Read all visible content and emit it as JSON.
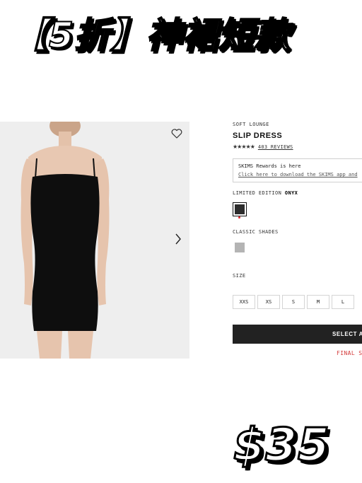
{
  "overlay": {
    "headline": "【5折】神裙短款",
    "price": "$35"
  },
  "product": {
    "collection": "SOFT LOUNGE",
    "title": "SLIP DRESS",
    "stars": "★★★★★",
    "rating_value": 4.5,
    "reviews": "403 REVIEWS",
    "rewards_title": "SKIMS Rewards is here",
    "rewards_link": "Click here to download the SKIMS app and",
    "limited_label": "LIMITED EDITION",
    "limited_color": "ONYX",
    "classic_label": "CLASSIC SHADES",
    "size_label": "SIZE",
    "sizes": [
      "XXS",
      "XS",
      "S",
      "M",
      "L"
    ],
    "select_button": "SELECT A",
    "final_sale": "FINAL SA"
  },
  "icons": {
    "favorite": "heart-icon",
    "next": "chevron-right-icon"
  },
  "colors": {
    "onyx": "#2d2d2d",
    "classic": "#b4b4b4",
    "accent_red": "#d33a3a",
    "button_dark": "#222222",
    "gallery_bg": "#eeeeee"
  }
}
